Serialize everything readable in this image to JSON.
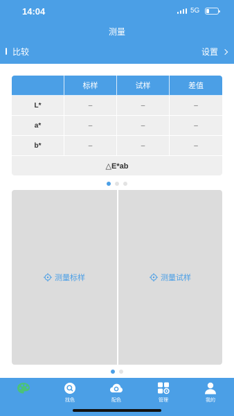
{
  "status_bar": {
    "time": "14:04",
    "network": "5G"
  },
  "header": {
    "title": "测量",
    "compare_label": "比较",
    "settings_label": "设置"
  },
  "table": {
    "columns": [
      "",
      "标样",
      "试样",
      "差值"
    ],
    "rows": [
      {
        "label": "L*",
        "values": [
          "–",
          "–",
          "–"
        ]
      },
      {
        "label": "a*",
        "values": [
          "–",
          "–",
          "–"
        ]
      },
      {
        "label": "b*",
        "values": [
          "–",
          "–",
          "–"
        ]
      }
    ],
    "delta_label": "△E*ab"
  },
  "table_pager": {
    "count": 3,
    "active": 0
  },
  "panels": {
    "left_label": "测量标样",
    "right_label": "测量试样"
  },
  "panel_pager": {
    "count": 2,
    "active": 0
  },
  "tabbar": {
    "tabs": [
      {
        "label": "",
        "icon": "palette-icon",
        "active": true
      },
      {
        "label": "找色",
        "icon": "search-color-icon",
        "active": false
      },
      {
        "label": "配色",
        "icon": "cloud-color-icon",
        "active": false
      },
      {
        "label": "管理",
        "icon": "grid-manage-icon",
        "active": false
      },
      {
        "label": "我的",
        "icon": "user-icon",
        "active": false
      }
    ]
  },
  "colors": {
    "primary": "#4b9fe6",
    "active_tab": "#4bc27a",
    "panel_bg": "#dcdcdc",
    "table_bg": "#efefef"
  }
}
